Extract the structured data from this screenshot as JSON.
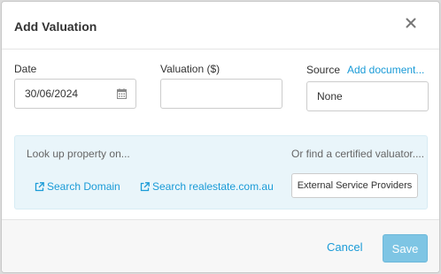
{
  "dialog": {
    "title": "Add Valuation"
  },
  "form": {
    "date_label": "Date",
    "date_value": "30/06/2024",
    "valuation_label": "Valuation ($)",
    "valuation_value": "",
    "source_label": "Source",
    "add_document_label": "Add document...",
    "source_value": "None"
  },
  "lookup": {
    "prompt": "Look up property on...",
    "links": [
      {
        "label": "Search Domain",
        "icon": "external-link-icon"
      },
      {
        "label": "Search realestate.com.au",
        "icon": "external-link-icon"
      }
    ],
    "valuator_prompt": "Or find a certified valuator....",
    "external_button_label": "External Service Providers"
  },
  "footer": {
    "cancel_label": "Cancel",
    "save_label": "Save"
  },
  "colors": {
    "accent": "#1a9bd7",
    "save_button": "#7ec5e4",
    "lookup_background": "#e9f5fa"
  }
}
